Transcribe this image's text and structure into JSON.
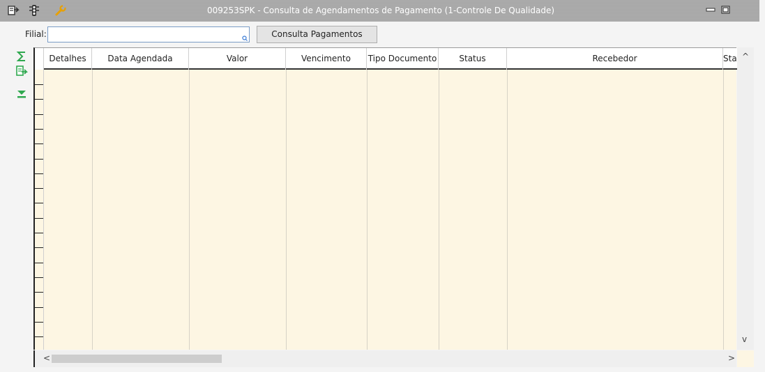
{
  "window": {
    "title": "009253SPK - Consulta de Agendamentos de Pagamento (1-Controle De Qualidade)"
  },
  "filter": {
    "label": "Filial:",
    "value": "",
    "search_button_label": "Consulta Pagamentos"
  },
  "grid": {
    "columns": [
      "Detalhes",
      "Data Agendada",
      "Valor",
      "Vencimento",
      "Tipo Documento",
      "Status",
      "Recebedor",
      "Stat"
    ],
    "rows": []
  },
  "icons": {
    "titlebar": [
      "export-icon",
      "traffic-light-icon",
      "wrench-icon"
    ],
    "side": [
      "sum-icon",
      "export-green-icon",
      "download-icon"
    ],
    "window_controls": [
      "minimize-icon",
      "restore-icon"
    ]
  },
  "colors": {
    "titlebar": "#a8a8a8",
    "grid_background": "#fdf6e3",
    "accent_green": "#2fa84f",
    "wrench_orange": "#e8a000"
  },
  "scroll": {
    "up_arrow": "^",
    "down_arrow": "v",
    "left_arrow": "<",
    "right_arrow": ">"
  }
}
